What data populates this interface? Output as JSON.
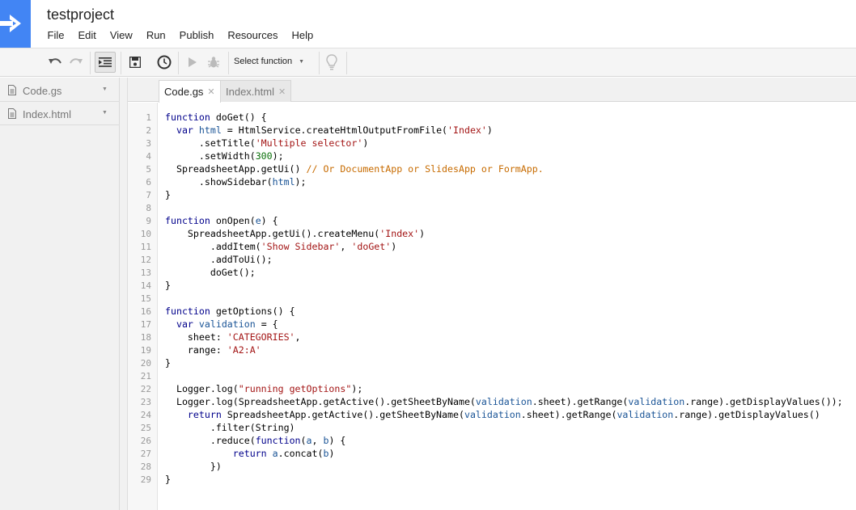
{
  "window": {
    "project_title": "testproject",
    "menu": [
      "File",
      "Edit",
      "View",
      "Run",
      "Publish",
      "Resources",
      "Help"
    ]
  },
  "toolbar": {
    "select_function_label": "Select function"
  },
  "sidebar": {
    "files": [
      "Code.gs",
      "Index.html"
    ]
  },
  "tabs": [
    {
      "label": "Code.gs",
      "active": true
    },
    {
      "label": "Index.html",
      "active": false
    }
  ],
  "colors": {
    "brand_blue": "#4285f4",
    "keyword": "#00008b",
    "string": "#a31515",
    "number": "#096f09",
    "comment": "#c76b00",
    "variable": "#1a5496"
  },
  "code": {
    "lines": [
      [
        [
          "kw",
          "function"
        ],
        [
          "t",
          " doGet() {"
        ]
      ],
      [
        [
          "t",
          "  "
        ],
        [
          "kw",
          "var"
        ],
        [
          "t",
          " "
        ],
        [
          "var",
          "html"
        ],
        [
          "t",
          " = HtmlService.createHtmlOutputFromFile("
        ],
        [
          "str",
          "'Index'"
        ],
        [
          "t",
          ")"
        ]
      ],
      [
        [
          "t",
          "      .setTitle("
        ],
        [
          "str",
          "'Multiple selector'"
        ],
        [
          "t",
          ")"
        ]
      ],
      [
        [
          "t",
          "      .setWidth("
        ],
        [
          "num",
          "300"
        ],
        [
          "t",
          ");"
        ]
      ],
      [
        [
          "t",
          "  SpreadsheetApp.getUi() "
        ],
        [
          "com",
          "// Or DocumentApp or SlidesApp or FormApp."
        ]
      ],
      [
        [
          "t",
          "      .showSidebar("
        ],
        [
          "var",
          "html"
        ],
        [
          "t",
          ");"
        ]
      ],
      [
        [
          "t",
          "}"
        ]
      ],
      [
        [
          "t",
          ""
        ]
      ],
      [
        [
          "kw",
          "function"
        ],
        [
          "t",
          " onOpen("
        ],
        [
          "var",
          "e"
        ],
        [
          "t",
          ") {"
        ]
      ],
      [
        [
          "t",
          "    SpreadsheetApp.getUi().createMenu("
        ],
        [
          "str",
          "'Index'"
        ],
        [
          "t",
          ")"
        ]
      ],
      [
        [
          "t",
          "        .addItem("
        ],
        [
          "str",
          "'Show Sidebar'"
        ],
        [
          "t",
          ", "
        ],
        [
          "str",
          "'doGet'"
        ],
        [
          "t",
          ")"
        ]
      ],
      [
        [
          "t",
          "        .addToUi();"
        ]
      ],
      [
        [
          "t",
          "        doGet();"
        ]
      ],
      [
        [
          "t",
          "}"
        ]
      ],
      [
        [
          "t",
          ""
        ]
      ],
      [
        [
          "kw",
          "function"
        ],
        [
          "t",
          " getOptions() {"
        ]
      ],
      [
        [
          "t",
          "  "
        ],
        [
          "kw",
          "var"
        ],
        [
          "t",
          " "
        ],
        [
          "var",
          "validation"
        ],
        [
          "t",
          " = {"
        ]
      ],
      [
        [
          "t",
          "    sheet: "
        ],
        [
          "str",
          "'CATEGORIES'"
        ],
        [
          "t",
          ","
        ]
      ],
      [
        [
          "t",
          "    range: "
        ],
        [
          "str",
          "'A2:A'"
        ]
      ],
      [
        [
          "t",
          "}"
        ]
      ],
      [
        [
          "t",
          ""
        ]
      ],
      [
        [
          "t",
          "  Logger.log("
        ],
        [
          "str",
          "\"running getOptions\""
        ],
        [
          "t",
          ");"
        ]
      ],
      [
        [
          "t",
          "  Logger.log(SpreadsheetApp.getActive().getSheetByName("
        ],
        [
          "var",
          "validation"
        ],
        [
          "t",
          ".sheet).getRange("
        ],
        [
          "var",
          "validation"
        ],
        [
          "t",
          ".range).getDisplayValues());"
        ]
      ],
      [
        [
          "t",
          "    "
        ],
        [
          "kw",
          "return"
        ],
        [
          "t",
          " SpreadsheetApp.getActive().getSheetByName("
        ],
        [
          "var",
          "validation"
        ],
        [
          "t",
          ".sheet).getRange("
        ],
        [
          "var",
          "validation"
        ],
        [
          "t",
          ".range).getDisplayValues()"
        ]
      ],
      [
        [
          "t",
          "        .filter(String)"
        ]
      ],
      [
        [
          "t",
          "        .reduce("
        ],
        [
          "kw",
          "function"
        ],
        [
          "t",
          "("
        ],
        [
          "var",
          "a"
        ],
        [
          "t",
          ", "
        ],
        [
          "var",
          "b"
        ],
        [
          "t",
          ") {"
        ]
      ],
      [
        [
          "t",
          "            "
        ],
        [
          "kw",
          "return"
        ],
        [
          "t",
          " "
        ],
        [
          "var",
          "a"
        ],
        [
          "t",
          ".concat("
        ],
        [
          "var",
          "b"
        ],
        [
          "t",
          ")"
        ]
      ],
      [
        [
          "t",
          "        })"
        ]
      ],
      [
        [
          "t",
          "}"
        ]
      ]
    ]
  }
}
